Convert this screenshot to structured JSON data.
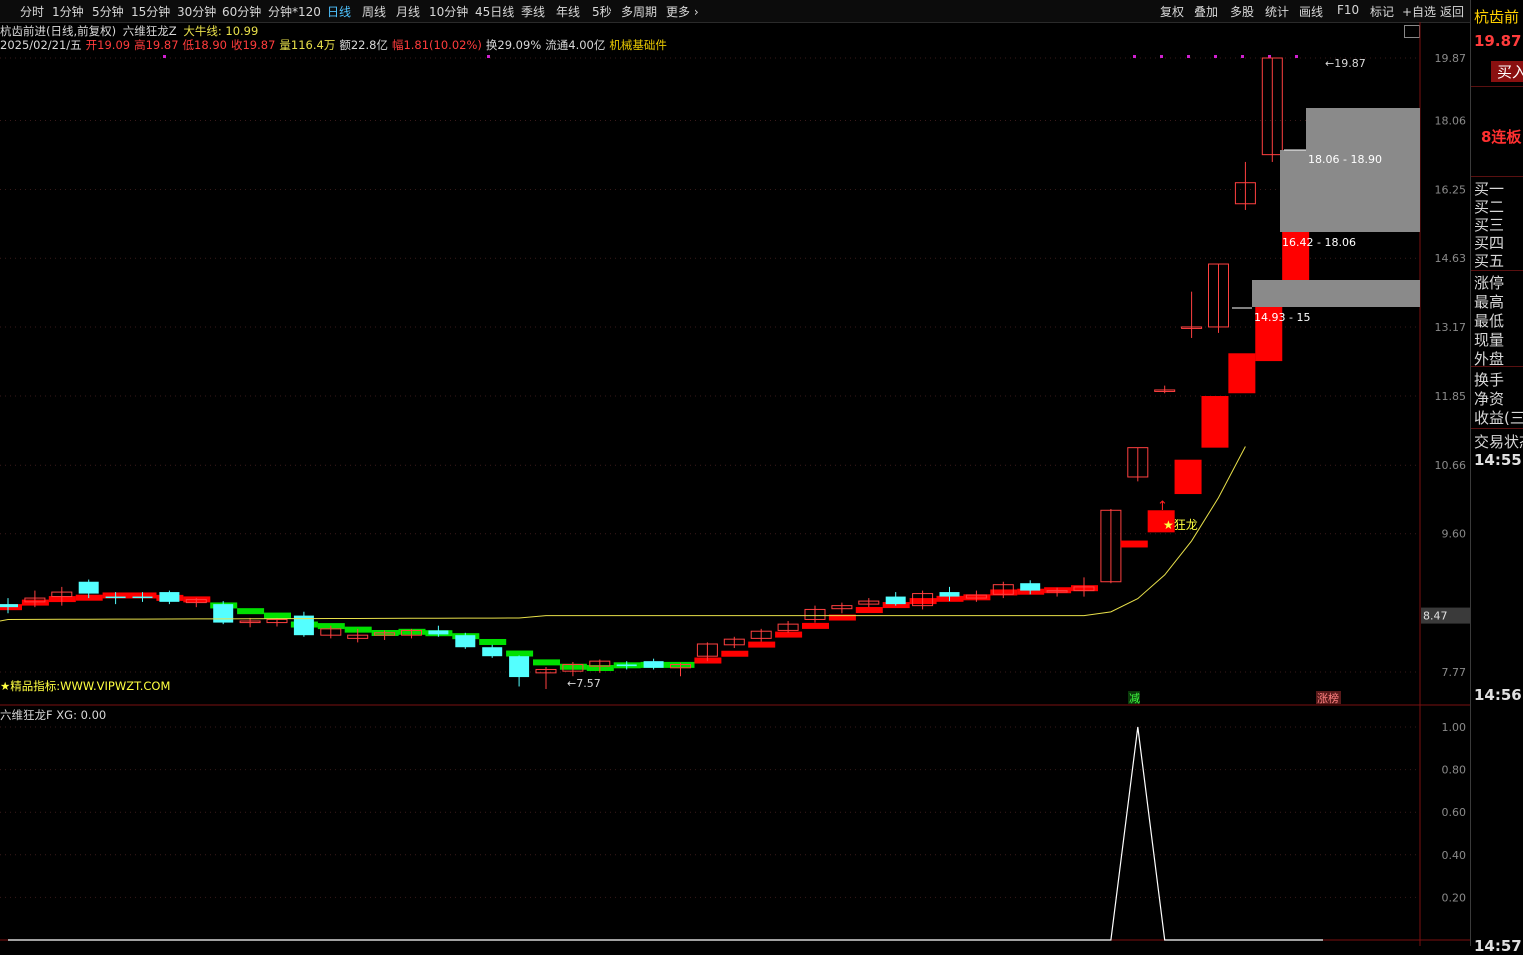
{
  "toolbar": {
    "periods": [
      "分时",
      "1分钟",
      "5分钟",
      "15分钟",
      "30分钟",
      "60分钟",
      "分钟*120",
      "日线",
      "周线",
      "月线",
      "10分钟",
      "45日线",
      "季线",
      "年线",
      "5秒",
      "多周期",
      "更多"
    ],
    "active_period": "日线",
    "actions": [
      "复权",
      "叠加",
      "多股",
      "统计",
      "画线",
      "F10",
      "标记",
      "+自选",
      "返回"
    ]
  },
  "info": {
    "stock_title": "杭齿前进(日线,前复权)",
    "indicator_name": "六维狂龙Z",
    "ma_label": "大牛线: 10.99",
    "date": "2025/02/21/五",
    "open": "开19.09",
    "high": "高19.87",
    "low": "低18.90",
    "close": "收19.87",
    "volume": "量116.4万",
    "amount": "额22.8亿",
    "change": "幅1.81(10.02%)",
    "turnover": "换29.09%",
    "float_cap": "流通4.00亿",
    "sector": "机械基础件"
  },
  "annotations": {
    "low_marker": "←7.57",
    "high_marker": "←19.87",
    "signal": "★狂龙",
    "watermark": "★精品指标:WWW.VIPWZT.COM",
    "zone1": "18.06 - 18.90",
    "zone2": "16.42 - 18.06",
    "zone3": "14.93 - 15",
    "reduce_tag": "减",
    "limit_up_tag": "涨榜"
  },
  "price_axis": {
    "ticks": [
      "19.87",
      "18.06",
      "16.25",
      "14.63",
      "13.17",
      "11.85",
      "10.66",
      "9.60",
      "8.47",
      "7.77"
    ],
    "current_label": "8.47"
  },
  "indicator_panel": {
    "title": "六维狂龙F",
    "value": "XG: 0.00",
    "ticks": [
      "1.00",
      "0.80",
      "0.60",
      "0.40",
      "0.20"
    ]
  },
  "right_panel": {
    "stock_short": "杭齿前",
    "price": "19.87",
    "buy_button": "买入",
    "streak": "8连板",
    "labels": [
      "买一",
      "买二",
      "买三",
      "买四",
      "买五",
      "涨停",
      "最高",
      "最低",
      "现量",
      "外盘",
      "换手",
      "净资",
      "收益(三)",
      "交易状态"
    ],
    "times": [
      "14:55",
      "14:56",
      "14:57"
    ]
  },
  "colors": {
    "up": "#ff0000",
    "down": "#54ffff",
    "ribbon_green": "#00e000",
    "ma_line": "#e8e04a",
    "zone": "#8a8a8a"
  },
  "chart_data": {
    "type": "candlestick",
    "ohlc": [
      [
        8.62,
        8.7,
        8.5,
        8.58
      ],
      [
        8.65,
        8.8,
        8.58,
        8.7
      ],
      [
        8.72,
        8.85,
        8.6,
        8.78
      ],
      [
        8.92,
        8.95,
        8.7,
        8.76
      ],
      [
        8.72,
        8.78,
        8.62,
        8.7
      ],
      [
        8.72,
        8.78,
        8.65,
        8.7
      ],
      [
        8.78,
        8.8,
        8.62,
        8.65
      ],
      [
        8.64,
        8.7,
        8.58,
        8.68
      ],
      [
        8.62,
        8.66,
        8.36,
        8.38
      ],
      [
        8.38,
        8.44,
        8.32,
        8.4
      ],
      [
        8.38,
        8.44,
        8.33,
        8.42
      ],
      [
        8.47,
        8.52,
        8.2,
        8.22
      ],
      [
        8.22,
        8.34,
        8.18,
        8.3
      ],
      [
        8.18,
        8.3,
        8.13,
        8.22
      ],
      [
        8.22,
        8.28,
        8.16,
        8.25
      ],
      [
        8.22,
        8.3,
        8.18,
        8.28
      ],
      [
        8.28,
        8.34,
        8.2,
        8.23
      ],
      [
        8.22,
        8.25,
        8.05,
        8.07
      ],
      [
        8.07,
        8.1,
        7.94,
        7.96
      ],
      [
        7.96,
        7.97,
        7.6,
        7.71
      ],
      [
        7.76,
        7.83,
        7.57,
        7.8
      ],
      [
        7.78,
        7.89,
        7.72,
        7.86
      ],
      [
        7.84,
        7.92,
        7.76,
        7.9
      ],
      [
        7.86,
        7.9,
        7.8,
        7.84
      ],
      [
        7.9,
        7.93,
        7.8,
        7.82
      ],
      [
        7.82,
        7.88,
        7.72,
        7.86
      ],
      [
        7.96,
        8.13,
        7.9,
        8.11
      ],
      [
        8.1,
        8.2,
        8.06,
        8.17
      ],
      [
        8.18,
        8.3,
        8.14,
        8.27
      ],
      [
        8.28,
        8.4,
        8.25,
        8.36
      ],
      [
        8.42,
        8.6,
        8.38,
        8.55
      ],
      [
        8.56,
        8.64,
        8.5,
        8.6
      ],
      [
        8.62,
        8.7,
        8.58,
        8.66
      ],
      [
        8.72,
        8.78,
        8.6,
        8.62
      ],
      [
        8.6,
        8.8,
        8.55,
        8.76
      ],
      [
        8.78,
        8.85,
        8.66,
        8.72
      ],
      [
        8.7,
        8.8,
        8.65,
        8.74
      ],
      [
        8.75,
        8.92,
        8.7,
        8.88
      ],
      [
        8.9,
        8.94,
        8.75,
        8.8
      ],
      [
        8.78,
        8.84,
        8.72,
        8.8
      ],
      [
        8.8,
        8.98,
        8.72,
        8.85
      ],
      [
        8.92,
        9.97,
        8.9,
        9.95
      ],
      [
        10.47,
        10.95,
        10.4,
        10.95
      ],
      [
        11.95,
        12.04,
        11.9,
        11.96
      ],
      [
        13.17,
        13.9,
        12.95,
        13.17
      ],
      [
        13.17,
        14.5,
        13.05,
        14.5
      ],
      [
        15.9,
        16.95,
        15.75,
        16.42
      ],
      [
        17.14,
        19.87,
        16.95,
        19.87
      ]
    ],
    "ma_label": "大牛线: 10.99",
    "xg_signal": [
      0,
      0,
      0,
      0,
      0,
      0,
      0,
      0,
      0,
      0,
      0,
      0,
      0,
      0,
      0,
      0,
      0,
      0,
      0,
      0,
      0,
      0,
      0,
      0,
      0,
      0,
      0,
      0,
      0,
      0,
      0,
      0,
      0,
      0,
      0,
      0,
      0,
      0,
      0,
      0,
      0,
      0,
      1,
      0,
      0,
      0,
      0,
      0
    ],
    "ylim": [
      7.2,
      20.3
    ]
  }
}
